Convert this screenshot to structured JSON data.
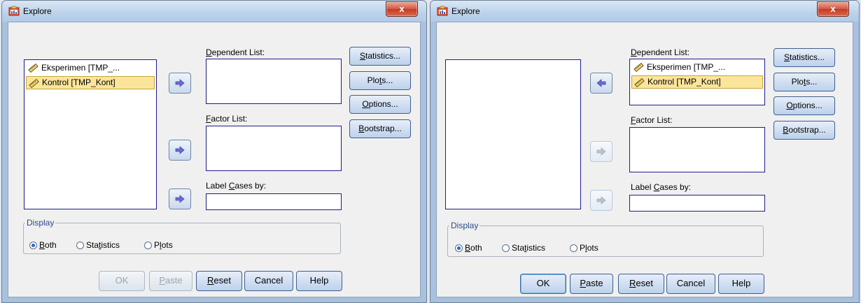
{
  "colors": {
    "selection": "#fbe59b",
    "list_border": "#1f1a8a",
    "arrow": "#6a6ad8"
  },
  "windows": [
    {
      "title": "Explore",
      "close_label": "x",
      "variables": [
        {
          "label": "Eksperimen [TMP_...",
          "selected": false,
          "icon": "ruler-icon"
        },
        {
          "label": "Kontrol [TMP_Kont]",
          "selected": true,
          "icon": "ruler-icon"
        }
      ],
      "dependent_list": {
        "label_pre": "",
        "label_acc": "D",
        "label_post": "ependent List:",
        "items": []
      },
      "factor_list": {
        "label_pre": "",
        "label_acc": "F",
        "label_post": "actor List:",
        "items": []
      },
      "label_cases": {
        "label_pre": "Label ",
        "label_acc": "C",
        "label_post": "ases by:",
        "value": ""
      },
      "side_buttons": [
        {
          "pre": "",
          "acc": "S",
          "post": "tatistics..."
        },
        {
          "pre": "Plo",
          "acc": "t",
          "post": "s..."
        },
        {
          "pre": "",
          "acc": "O",
          "post": "ptions..."
        },
        {
          "pre": "",
          "acc": "B",
          "post": "ootstrap..."
        }
      ],
      "display": {
        "legend": "Display",
        "options": [
          {
            "pre": "",
            "acc": "B",
            "post": "oth",
            "checked": true
          },
          {
            "pre": "Sta",
            "acc": "t",
            "post": "istics",
            "checked": false
          },
          {
            "pre": "P",
            "acc": "l",
            "post": "ots",
            "checked": false
          }
        ]
      },
      "bottom_buttons": [
        {
          "pre": "OK",
          "acc": "",
          "post": "",
          "enabled": false
        },
        {
          "pre": "",
          "acc": "P",
          "post": "aste",
          "enabled": false
        },
        {
          "pre": "",
          "acc": "R",
          "post": "eset",
          "enabled": true
        },
        {
          "pre": "Cancel",
          "acc": "",
          "post": "",
          "enabled": true
        },
        {
          "pre": "Help",
          "acc": "",
          "post": "",
          "enabled": true
        }
      ],
      "arrow_states": [
        "right",
        "right",
        "right"
      ]
    },
    {
      "title": "Explore",
      "close_label": "x",
      "variables": [],
      "dependent_list": {
        "label_pre": "",
        "label_acc": "D",
        "label_post": "ependent List:",
        "items": [
          {
            "label": "Eksperimen [TMP_...",
            "selected": false,
            "icon": "ruler-icon"
          },
          {
            "label": "Kontrol [TMP_Kont]",
            "selected": true,
            "icon": "ruler-icon"
          }
        ]
      },
      "factor_list": {
        "label_pre": "",
        "label_acc": "F",
        "label_post": "actor List:",
        "items": []
      },
      "label_cases": {
        "label_pre": "Label ",
        "label_acc": "C",
        "label_post": "ases by:",
        "value": ""
      },
      "side_buttons": [
        {
          "pre": "",
          "acc": "S",
          "post": "tatistics..."
        },
        {
          "pre": "Plo",
          "acc": "t",
          "post": "s..."
        },
        {
          "pre": "",
          "acc": "O",
          "post": "ptions..."
        },
        {
          "pre": "",
          "acc": "B",
          "post": "ootstrap..."
        }
      ],
      "display": {
        "legend": "Display",
        "options": [
          {
            "pre": "",
            "acc": "B",
            "post": "oth",
            "checked": true
          },
          {
            "pre": "Sta",
            "acc": "t",
            "post": "istics",
            "checked": false
          },
          {
            "pre": "P",
            "acc": "l",
            "post": "ots",
            "checked": false
          }
        ]
      },
      "bottom_buttons": [
        {
          "pre": "OK",
          "acc": "",
          "post": "",
          "enabled": true
        },
        {
          "pre": "",
          "acc": "P",
          "post": "aste",
          "enabled": true
        },
        {
          "pre": "",
          "acc": "R",
          "post": "eset",
          "enabled": true
        },
        {
          "pre": "Cancel",
          "acc": "",
          "post": "",
          "enabled": true
        },
        {
          "pre": "Help",
          "acc": "",
          "post": "",
          "enabled": true
        }
      ],
      "arrow_states": [
        "left",
        "right-disabled",
        "right-disabled"
      ]
    }
  ]
}
